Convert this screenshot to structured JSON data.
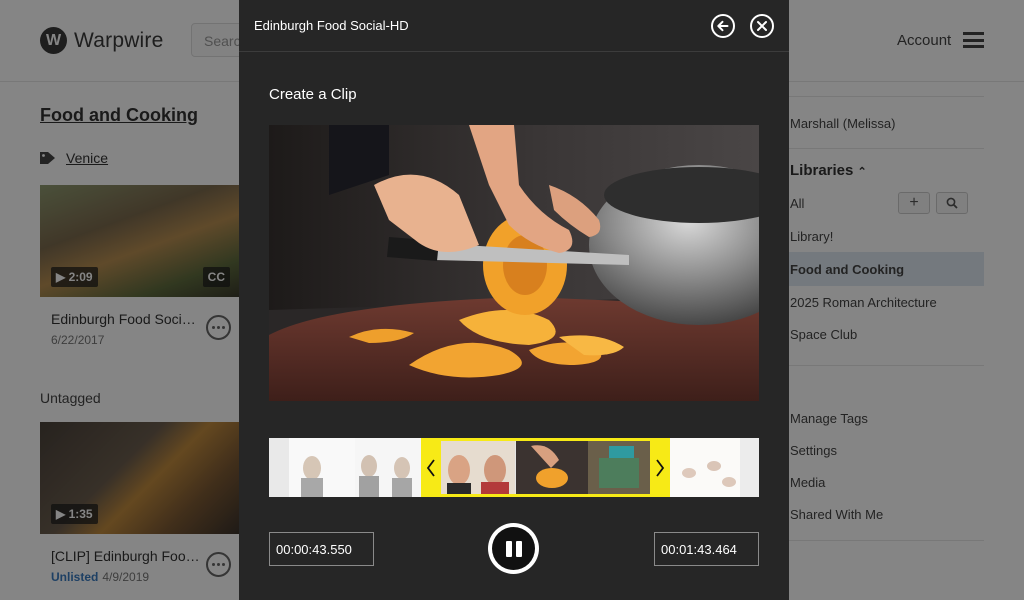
{
  "background": {
    "logo_letter": "W",
    "logo_text": "Warpwire",
    "search_placeholder": "Search",
    "account_label": "Account",
    "section_title": "Food and Cooking",
    "tag_label": "Venice",
    "cards": [
      {
        "duration": "2:09",
        "cc": "CC",
        "title": "Edinburgh Food Social-HD",
        "date": "6/22/2017"
      },
      {
        "duration": "1:35",
        "title": "[CLIP] Edinburgh Food Social-HD",
        "status": "Unlisted",
        "date": "4/9/2019"
      }
    ],
    "untagged_label": "Untagged",
    "right_panel": {
      "user": "Marshall (Melissa)",
      "libraries_heading": "Libraries",
      "add_symbol": "+",
      "items": [
        "All",
        "Library!",
        "Food and Cooking",
        "2025 Roman Architecture",
        "Space Club"
      ],
      "more_items": [
        "Manage Tags",
        "Settings",
        "Media",
        "Shared With Me"
      ]
    }
  },
  "modal": {
    "title": "Edinburgh Food Social-HD",
    "heading": "Create a Clip",
    "start_time": "00:00:43.550",
    "end_time": "00:01:43.464"
  },
  "colors": {
    "modal_bg": "#262626",
    "selection": "#f7ea16",
    "overlay": "rgba(0,0,0,0.48)"
  }
}
